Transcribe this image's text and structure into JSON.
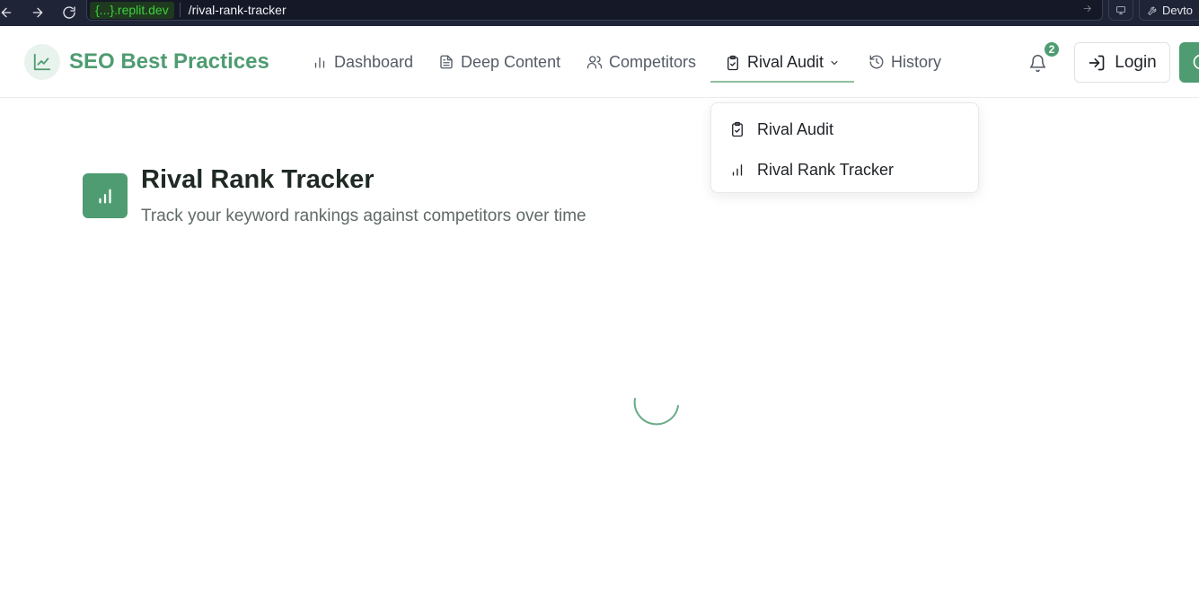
{
  "browser": {
    "url_domain": "{...}.replit.dev",
    "url_path": "/rival-rank-tracker",
    "devtools_label": "Devto"
  },
  "header": {
    "brand": "SEO Best Practices",
    "nav": [
      {
        "label": "Dashboard",
        "icon": "bar-chart-icon"
      },
      {
        "label": "Deep Content",
        "icon": "file-text-icon"
      },
      {
        "label": "Competitors",
        "icon": "users-icon"
      },
      {
        "label": "Rival Audit",
        "icon": "clipboard-check-icon",
        "active": true
      },
      {
        "label": "History",
        "icon": "history-icon"
      }
    ],
    "notification_count": "2",
    "login_label": "Login"
  },
  "dropdown": {
    "items": [
      {
        "label": "Rival Audit",
        "icon": "clipboard-check-icon"
      },
      {
        "label": "Rival Rank Tracker",
        "icon": "bar-chart-icon"
      }
    ]
  },
  "page": {
    "title": "Rival Rank Tracker",
    "subtitle": "Track your keyword rankings against competitors over time"
  },
  "colors": {
    "accent": "#4f9c72",
    "browser_bg": "#202437"
  }
}
